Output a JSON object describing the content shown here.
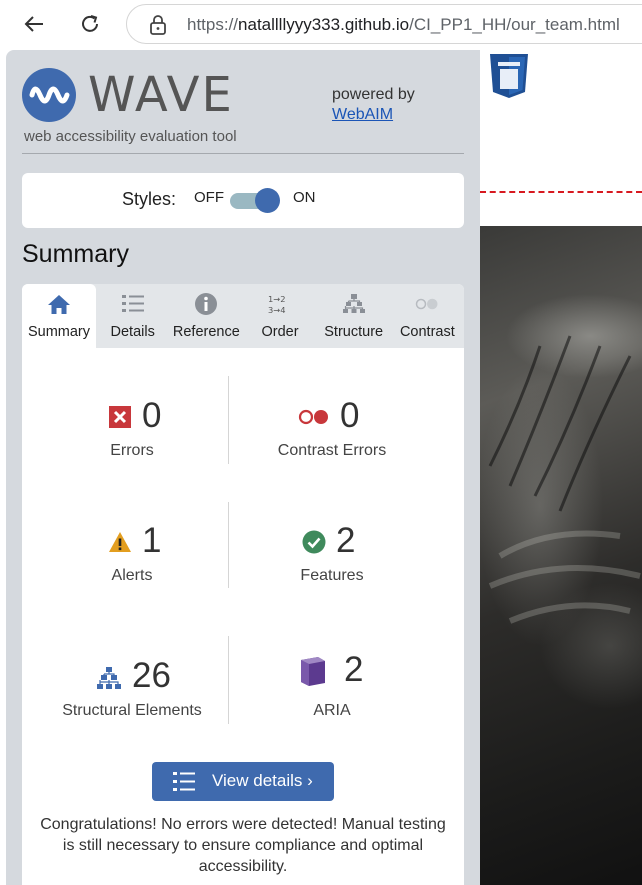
{
  "browser": {
    "url_prefix": "https://",
    "url_domain": "natallllyyy333.github.io",
    "url_path": "/CI_PP1_HH/our_team.html"
  },
  "wave": {
    "logo_text": "WAVE",
    "tagline": "web accessibility evaluation tool",
    "powered_by": "powered by",
    "webaim_link": "WebAIM",
    "styles_label": "Styles:",
    "toggle_off": "OFF",
    "toggle_on": "ON",
    "section_title": "Summary",
    "tabs": [
      {
        "label": "Summary",
        "icon": "home-icon"
      },
      {
        "label": "Details",
        "icon": "list-icon"
      },
      {
        "label": "Reference",
        "icon": "info-icon"
      },
      {
        "label": "Order",
        "icon": "order-icon"
      },
      {
        "label": "Structure",
        "icon": "structure-icon"
      },
      {
        "label": "Contrast",
        "icon": "contrast-icon"
      }
    ],
    "stats": {
      "errors": {
        "value": "0",
        "label": "Errors"
      },
      "contrast_errors": {
        "value": "0",
        "label": "Contrast Errors"
      },
      "alerts": {
        "value": "1",
        "label": "Alerts"
      },
      "features": {
        "value": "2",
        "label": "Features"
      },
      "structural": {
        "value": "26",
        "label": "Structural Elements"
      },
      "aria": {
        "value": "2",
        "label": "ARIA"
      }
    },
    "view_details": "View details ›",
    "congrats": "Congratulations! No errors were detected! Manual testing is still necessary to ensure compliance and optimal accessibility."
  },
  "colors": {
    "accent": "#3f6aae",
    "error": "#c8373b",
    "alert": "#e39e1f",
    "feature": "#3f8a5c",
    "aria": "#5c3a8f"
  }
}
